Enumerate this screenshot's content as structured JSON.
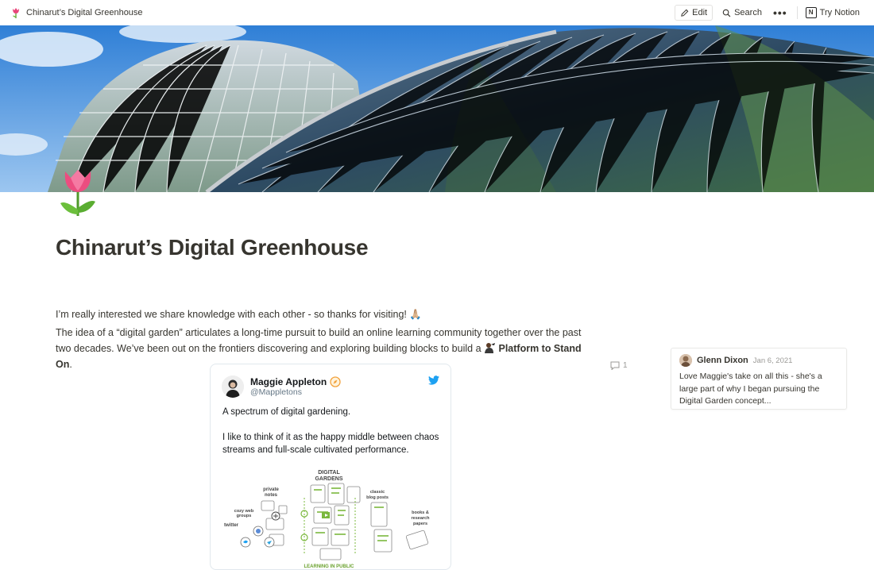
{
  "topbar": {
    "page_name": "Chinarut’s Digital Greenhouse",
    "edit_label": "Edit",
    "search_label": "Search",
    "more_label": "•••",
    "try_label": "Try Notion"
  },
  "page": {
    "title": "Chinarut’s Digital Greenhouse",
    "para1": "I’m really interested we share knowledge with each other - so thanks for visiting! 🙏🏼",
    "para2_start": "The idea of a “digital garden” articulates a long-time pursuit to build an online learning community together over the past two decades. We’ve been out on the frontiers discovering and exploring building blocks to build a ",
    "para2_link": "Platform to Stand On",
    "para2_end": "."
  },
  "comments": {
    "count": "1",
    "author": "Glenn Dixon",
    "date": "Jan 6, 2021",
    "body": "Love Maggie's take on all this - she's a large part of why I began pursuing the Digital Garden concept..."
  },
  "tweet": {
    "name": "Maggie Appleton",
    "handle": "@Mappletons",
    "line1": "A spectrum of digital gardening.",
    "line2": "I like to think of it as the happy middle between chaos streams and full-scale cultivated performance."
  },
  "illustration": {
    "label_digital": "DIGITAL",
    "label_gardens": "GARDENS",
    "label_private": "private",
    "label_notes": "notes",
    "label_cozy": "cozy web",
    "label_groups": "groups",
    "label_twitter": "twitter",
    "label_classic": "classic",
    "label_blog": "blog posts",
    "label_books": "books &",
    "label_research": "research",
    "label_papers": "papers",
    "label_public": "LEARNING IN PUBLIC"
  },
  "colors": {
    "accent_twitter": "#1da1f2",
    "text": "#37352f",
    "muted": "#9b9a97",
    "green": "#7bb83d"
  }
}
